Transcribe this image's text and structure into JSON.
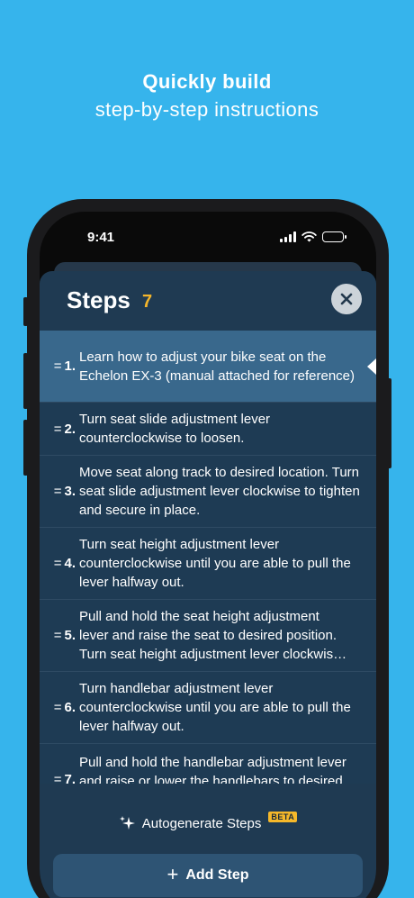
{
  "headline": {
    "title": "Quickly build",
    "subtitle": "step-by-step instructions"
  },
  "status_bar": {
    "time": "9:41"
  },
  "sheet": {
    "title": "Steps",
    "count": "7",
    "close_icon": "close-x-icon"
  },
  "steps": [
    {
      "number": "1.",
      "text": "Learn how to adjust your bike seat on the Echelon EX-3 (manual attached for reference)",
      "selected": true
    },
    {
      "number": "2.",
      "text": "Turn seat slide adjustment lever counterclockwise to loosen."
    },
    {
      "number": "3.",
      "text": "Move seat along track to desired location. Turn seat slide adjustment lever clockwise to tighten and secure in place."
    },
    {
      "number": "4.",
      "text": "Turn seat height adjustment lever counterclockwise until you are able to pull the lever halfway out."
    },
    {
      "number": "5.",
      "text_lines": [
        "Pull and hold the seat height adjustment",
        "lever and raise the seat to desired position.",
        "Turn seat height adjustment lever clockwis…"
      ]
    },
    {
      "number": "6.",
      "text": "Turn handlebar adjustment lever counterclockwise until you are able to pull the lever halfway out."
    },
    {
      "number": "7.",
      "text_lines": [
        "Pull and hold the handlebar adjustment lever",
        "and raise or lower the handlebars to desired"
      ]
    }
  ],
  "autogenerate": {
    "icon": "sparkles-icon",
    "label": "Autogenerate Steps",
    "badge": "BETA"
  },
  "add_step": {
    "icon": "plus-icon",
    "label": "Add Step"
  },
  "colors": {
    "background": "#36b4ec",
    "sheet": "#1f3a52",
    "selected_row": "#39688c",
    "accent_count": "#f3b52b",
    "beta_badge": "#f5b82a"
  }
}
